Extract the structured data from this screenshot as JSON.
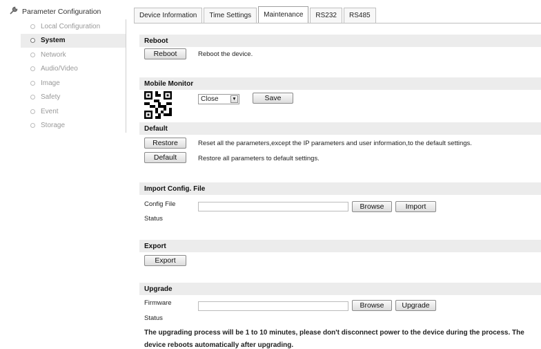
{
  "sidebar": {
    "title": "Parameter Configuration",
    "items": [
      {
        "label": "Local Configuration",
        "active": false
      },
      {
        "label": "System",
        "active": true
      },
      {
        "label": "Network",
        "active": false
      },
      {
        "label": "Audio/Video",
        "active": false
      },
      {
        "label": "Image",
        "active": false
      },
      {
        "label": "Safety",
        "active": false
      },
      {
        "label": "Event",
        "active": false
      },
      {
        "label": "Storage",
        "active": false
      }
    ]
  },
  "tabs": [
    {
      "label": "Device Information",
      "active": false
    },
    {
      "label": "Time Settings",
      "active": false
    },
    {
      "label": "Maintenance",
      "active": true
    },
    {
      "label": "RS232",
      "active": false
    },
    {
      "label": "RS485",
      "active": false
    }
  ],
  "reboot": {
    "title": "Reboot",
    "button": "Reboot",
    "description": "Reboot the device."
  },
  "mobile_monitor": {
    "title": "Mobile Monitor",
    "select_value": "Close",
    "save_button": "Save"
  },
  "default": {
    "title": "Default",
    "restore_button": "Restore",
    "restore_description": "Reset all the parameters,except the IP parameters and user information,to the default settings.",
    "default_button": "Default",
    "default_description": "Restore all parameters to default settings."
  },
  "import": {
    "title": "Import Config. File",
    "config_file_label": "Config File",
    "config_file_value": "",
    "browse_button": "Browse",
    "import_button": "Import",
    "status_label": "Status"
  },
  "export": {
    "title": "Export",
    "export_button": "Export"
  },
  "upgrade": {
    "title": "Upgrade",
    "firmware_label": "Firmware",
    "firmware_value": "",
    "browse_button": "Browse",
    "upgrade_button": "Upgrade",
    "status_label": "Status",
    "note": "The upgrading process will be 1 to 10 minutes, please don't disconnect power to the device during the process. The",
    "note_cont": "device reboots automatically after upgrading."
  }
}
